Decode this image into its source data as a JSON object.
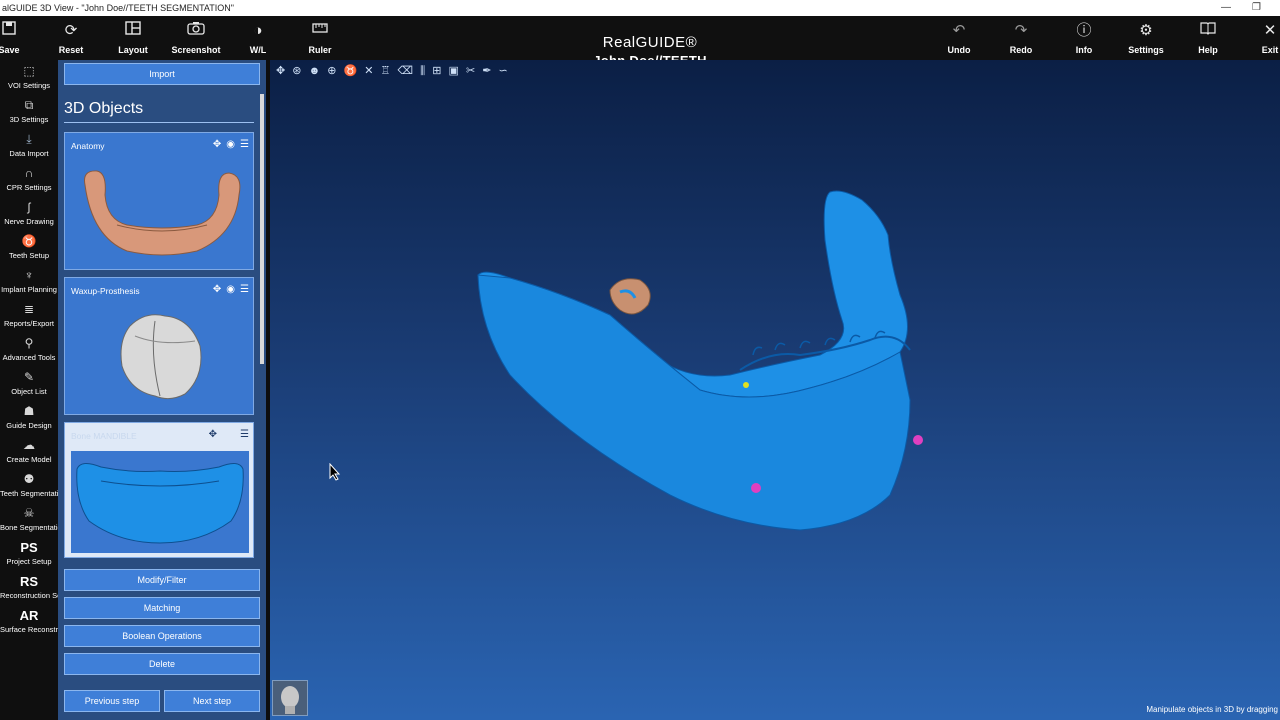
{
  "window": {
    "title": "alGUIDE 3D View  -  \"John Doe//TEETH SEGMENTATION\"",
    "controls": [
      "—",
      "❐"
    ]
  },
  "toolbar": {
    "left": [
      {
        "label": "Save",
        "icon": "save-icon"
      },
      {
        "label": "Reset",
        "icon": "reset-icon"
      },
      {
        "label": "Layout",
        "icon": "layout-icon"
      },
      {
        "label": "Screenshot",
        "icon": "camera-icon"
      },
      {
        "label": "W/L",
        "icon": "contrast-icon"
      },
      {
        "label": "Ruler",
        "icon": "ruler-icon"
      }
    ],
    "right": [
      {
        "label": "Undo",
        "icon": "undo-icon"
      },
      {
        "label": "Redo",
        "icon": "redo-icon"
      },
      {
        "label": "Info",
        "icon": "info-icon"
      },
      {
        "label": "Settings",
        "icon": "gear-icon"
      },
      {
        "label": "Help",
        "icon": "book-icon"
      },
      {
        "label": "Exit",
        "icon": "close-icon"
      }
    ]
  },
  "brand": {
    "logo": "RealGUIDE®",
    "subtitle": "John Doe//TEETH SEGMENTATION"
  },
  "sidebar": {
    "items": [
      {
        "label": "VOI Settings",
        "icon": "voi-icon"
      },
      {
        "label": "3D Settings",
        "icon": "cube-icon"
      },
      {
        "label": "Data Import",
        "icon": "download-icon",
        "active": true
      },
      {
        "label": "CPR Settings",
        "icon": "arch-icon"
      },
      {
        "label": "Nerve Drawing",
        "icon": "nerve-icon"
      },
      {
        "label": "Teeth Setup",
        "icon": "tooth-icon"
      },
      {
        "label": "Implant Planning",
        "icon": "implant-icon"
      },
      {
        "label": "Reports/Export",
        "icon": "report-icon"
      },
      {
        "label": "Advanced Tools",
        "icon": "tools-icon"
      },
      {
        "label": "Object List",
        "icon": "list-icon"
      },
      {
        "label": "Guide Design",
        "icon": "guide-icon"
      },
      {
        "label": "Create Model",
        "icon": "model-icon"
      },
      {
        "label": "Teeth Segmentation",
        "icon": "tooth-seg-icon"
      },
      {
        "label": "Bone Segmentation",
        "icon": "bone-seg-icon"
      },
      {
        "label": "Project Setup",
        "icon_text": "PS"
      },
      {
        "label": "Reconstruction Setup",
        "icon_text": "RS"
      },
      {
        "label": "Surface Reconstruction",
        "icon_text": "AR"
      }
    ]
  },
  "panel": {
    "import_label": "Import",
    "title": "3D Objects",
    "objects": [
      {
        "name": "Anatomy",
        "selected": false,
        "icons": [
          "move-icon",
          "eye-icon",
          "menu-icon"
        ]
      },
      {
        "name": "Waxup-Prosthesis",
        "selected": false,
        "icons": [
          "move-icon",
          "eye-icon",
          "menu-icon"
        ]
      },
      {
        "name": "Bone MANDIBLE",
        "selected": true,
        "icons": [
          "move-icon",
          "menu-icon"
        ]
      }
    ],
    "actions": [
      "Modify/Filter",
      "Matching",
      "Boolean Operations",
      "Delete"
    ],
    "prev_label": "Previous step",
    "next_label": "Next step"
  },
  "viewport": {
    "status": "Manipulate objects in 3D by dragging",
    "colors": {
      "bone": "#1e90e6",
      "marker": "#e040c0",
      "crown": "#c89070"
    }
  }
}
